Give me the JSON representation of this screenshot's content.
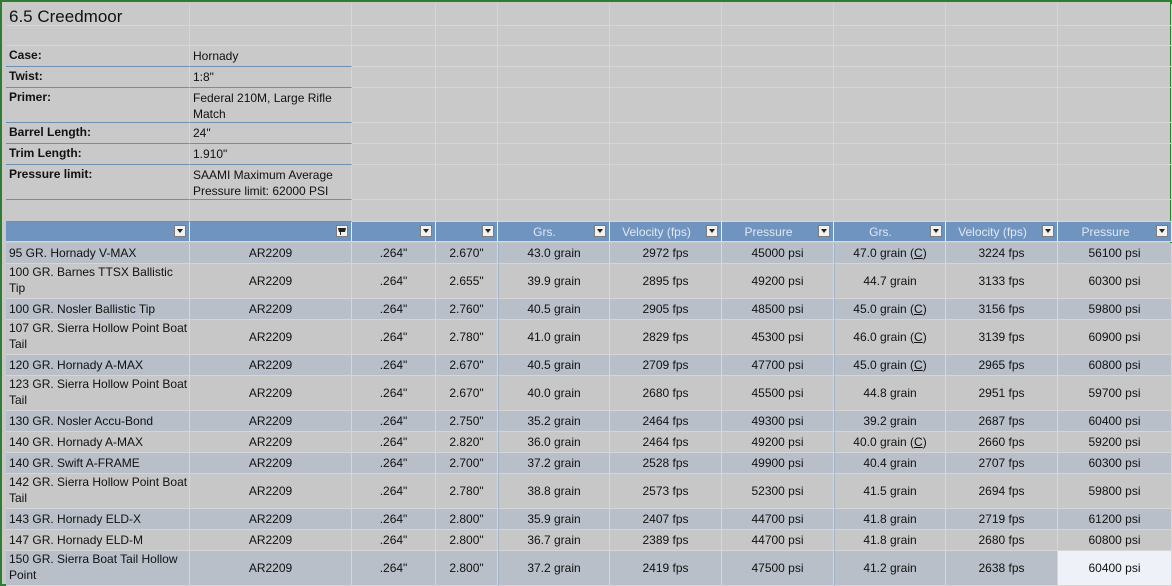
{
  "sheet": {
    "title": "6.5 Creedmoor",
    "specs": [
      {
        "label": "Case:",
        "value": "Hornady"
      },
      {
        "label": "Twist:",
        "value": "1:8\""
      },
      {
        "label": "Primer:",
        "value": "Federal 210M, Large Rifle Match"
      },
      {
        "label": "Barrel Length:",
        "value": "24\""
      },
      {
        "label": "Trim Length:",
        "value": "1.910\""
      },
      {
        "label": "Pressure limit:",
        "value": "SAAMI Maximum Average Pressure limit: 62000 PSI"
      }
    ],
    "headers": [
      "",
      "",
      "",
      "",
      "Grs.",
      "Velocity (fps)",
      "Pressure",
      "Grs.",
      "Velocity (fps)",
      "Pressure"
    ],
    "rows": [
      {
        "bullet": "95 GR. Hornady V-MAX",
        "powder": "AR2209",
        "dia": ".264\"",
        "oal": "2.670\"",
        "start_grs": "43.0 grain",
        "start_vel": "2972 fps",
        "start_psi": "45000 psi",
        "max_grs": "47.0 grain",
        "max_c": "C",
        "max_vel": "3224 fps",
        "max_psi": "56100 psi"
      },
      {
        "bullet": "100 GR. Barnes TTSX Ballistic Tip",
        "powder": "AR2209",
        "dia": ".264\"",
        "oal": "2.655\"",
        "start_grs": "39.9 grain",
        "start_vel": "2895 fps",
        "start_psi": "49200 psi",
        "max_grs": "44.7 grain",
        "max_c": "",
        "max_vel": "3133 fps",
        "max_psi": "60300 psi"
      },
      {
        "bullet": "100 GR. Nosler Ballistic Tip",
        "powder": "AR2209",
        "dia": ".264\"",
        "oal": "2.760\"",
        "start_grs": "40.5 grain",
        "start_vel": "2905 fps",
        "start_psi": "48500 psi",
        "max_grs": "45.0 grain",
        "max_c": "C",
        "max_vel": "3156 fps",
        "max_psi": "59800 psi"
      },
      {
        "bullet": "107 GR. Sierra Hollow Point Boat Tail",
        "powder": "AR2209",
        "dia": ".264\"",
        "oal": "2.780\"",
        "start_grs": "41.0 grain",
        "start_vel": "2829 fps",
        "start_psi": "45300 psi",
        "max_grs": "46.0 grain",
        "max_c": "C",
        "max_vel": "3139 fps",
        "max_psi": "60900 psi"
      },
      {
        "bullet": "120 GR. Hornady A-MAX",
        "powder": "AR2209",
        "dia": ".264\"",
        "oal": "2.670\"",
        "start_grs": "40.5 grain",
        "start_vel": "2709 fps",
        "start_psi": "47700 psi",
        "max_grs": "45.0 grain",
        "max_c": "C",
        "max_vel": "2965 fps",
        "max_psi": "60800 psi"
      },
      {
        "bullet": "123 GR. Sierra Hollow Point Boat Tail",
        "powder": "AR2209",
        "dia": ".264\"",
        "oal": "2.670\"",
        "start_grs": "40.0 grain",
        "start_vel": "2680 fps",
        "start_psi": "45500 psi",
        "max_grs": "44.8 grain",
        "max_c": "",
        "max_vel": "2951 fps",
        "max_psi": "59700 psi"
      },
      {
        "bullet": "130 GR. Nosler Accu-Bond",
        "powder": "AR2209",
        "dia": ".264\"",
        "oal": "2.750\"",
        "start_grs": "35.2 grain",
        "start_vel": "2464 fps",
        "start_psi": "49300 psi",
        "max_grs": "39.2 grain",
        "max_c": "",
        "max_vel": "2687 fps",
        "max_psi": "60400 psi"
      },
      {
        "bullet": "140 GR. Hornady A-MAX",
        "powder": "AR2209",
        "dia": ".264\"",
        "oal": "2.820\"",
        "start_grs": "36.0 grain",
        "start_vel": "2464 fps",
        "start_psi": "49200 psi",
        "max_grs": "40.0 grain",
        "max_c": "C",
        "max_vel": "2660 fps",
        "max_psi": "59200 psi"
      },
      {
        "bullet": "140 GR. Swift A-FRAME",
        "powder": "AR2209",
        "dia": ".264\"",
        "oal": "2.700\"",
        "start_grs": "37.2 grain",
        "start_vel": "2528 fps",
        "start_psi": "49900 psi",
        "max_grs": "40.4 grain",
        "max_c": "",
        "max_vel": "2707 fps",
        "max_psi": "60300 psi"
      },
      {
        "bullet": "142 GR. Sierra Hollow Point Boat Tail",
        "powder": "AR2209",
        "dia": ".264\"",
        "oal": "2.780\"",
        "start_grs": "38.8 grain",
        "start_vel": "2573 fps",
        "start_psi": "52300 psi",
        "max_grs": "41.5 grain",
        "max_c": "",
        "max_vel": "2694 fps",
        "max_psi": "59800 psi"
      },
      {
        "bullet": "143 GR. Hornady ELD-X",
        "powder": "AR2209",
        "dia": ".264\"",
        "oal": "2.800\"",
        "start_grs": "35.9 grain",
        "start_vel": "2407 fps",
        "start_psi": "44700 psi",
        "max_grs": "41.8 grain",
        "max_c": "",
        "max_vel": "2719 fps",
        "max_psi": "61200 psi"
      },
      {
        "bullet": "147 GR. Hornady ELD-M",
        "powder": "AR2209",
        "dia": ".264\"",
        "oal": "2.800\"",
        "start_grs": "36.7 grain",
        "start_vel": "2389 fps",
        "start_psi": "44700 psi",
        "max_grs": "41.8 grain",
        "max_c": "",
        "max_vel": "2680 fps",
        "max_psi": "60800 psi"
      },
      {
        "bullet": "150 GR. Sierra Boat Tail Hollow Point",
        "powder": "AR2209",
        "dia": ".264\"",
        "oal": "2.800\"",
        "start_grs": "37.2 grain",
        "start_vel": "2419 fps",
        "start_psi": "47500 psi",
        "max_grs": "41.2 grain",
        "max_c": "",
        "max_vel": "2638 fps",
        "max_psi": "60400 psi"
      }
    ]
  }
}
